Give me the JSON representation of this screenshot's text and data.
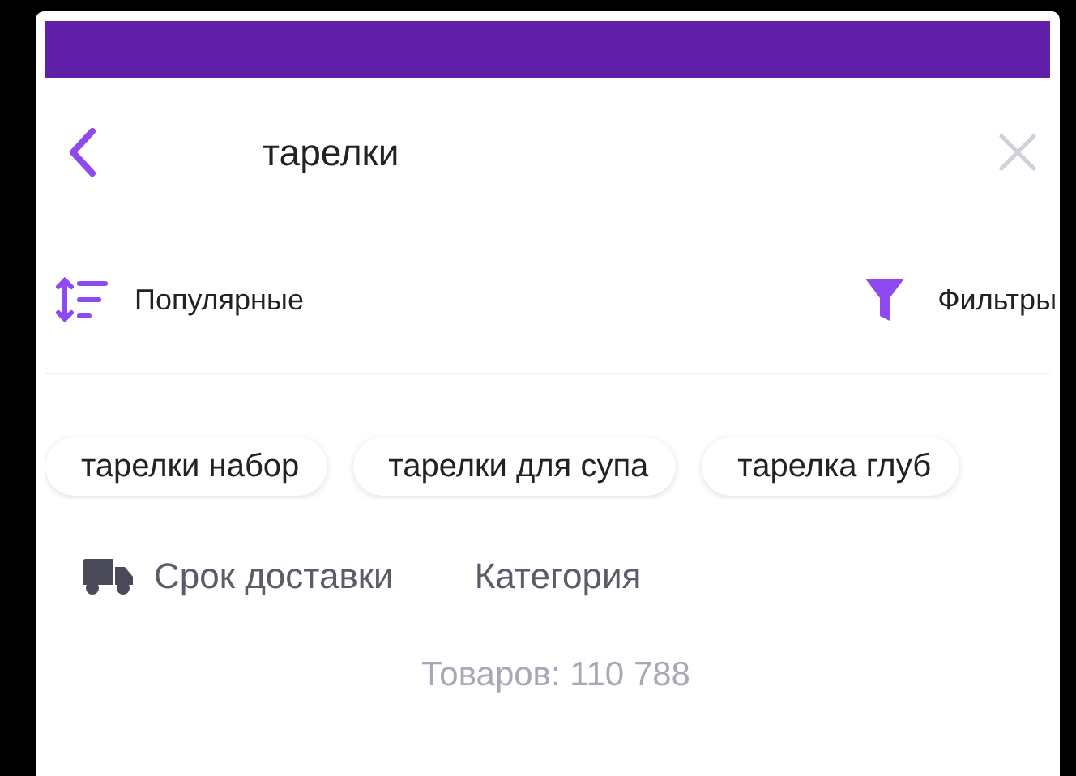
{
  "search": {
    "query": "тарелки"
  },
  "sort": {
    "label": "Популярные"
  },
  "filter": {
    "label": "Фильтры"
  },
  "suggestions": [
    {
      "label": "тарелки набор"
    },
    {
      "label": "тарелки для супа"
    },
    {
      "label": "тарелка глуб"
    }
  ],
  "facets": [
    {
      "kind": "delivery",
      "label": "Срок доставки"
    },
    {
      "kind": "plain",
      "label": "Категория"
    }
  ],
  "result_count": "Товаров: 110 788"
}
